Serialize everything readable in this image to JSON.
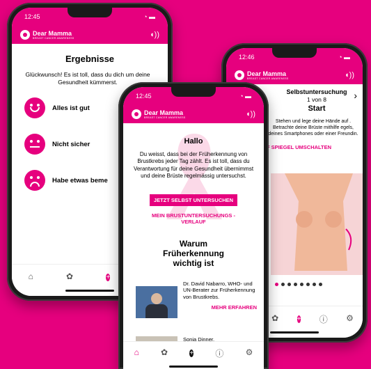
{
  "left": {
    "time": "12:45",
    "brand": "Dear Mamma",
    "brand_tag": "BREAST CANCER AWARENESS",
    "title": "Ergebnisse",
    "intro": "Glückwunsch! Es ist toll, dass du dich um deine Gesundheit kümmerst.",
    "options": [
      {
        "label": "Alles ist gut",
        "mood": "happy"
      },
      {
        "label": "Nicht sicher",
        "mood": "neutral"
      },
      {
        "label": "Habe etwas beme",
        "mood": "sad"
      }
    ]
  },
  "right": {
    "time": "12:46",
    "brand": "Dear Mamma",
    "brand_tag": "BREAST CANCER AWARENESS",
    "heading": "Selbstuntersuchung",
    "step": "1 von 8",
    "subheading": "Start",
    "text": "Stehen und lege deine Hände auf . Betrachte deine Brüste mithilfe egels, deines Smartphones oder einer Freundin.",
    "switch_label": "F SPIEGEL UMSCHALTEN",
    "next_icon": "chevron-right-icon"
  },
  "center": {
    "time": "12:45",
    "brand": "Dear Mamma",
    "brand_tag": "BREAST CANCER AWARENESS",
    "hello": "Hallo",
    "body": "Du weisst, dass bei der Früherkennung von Brustkrebs jeder Tag zählt. Es ist toll, dass du Verantwortung für deine Gesundheit übernimmst und deine Brüste regelmässig untersuchst.",
    "cta_primary": "JETZT SELBST UNTERSUCHEN",
    "cta_secondary": "MEIN BRUSTUNTERSUCHUNGS -VERLAUF",
    "section_title": "Warum Früherkennung wichtig ist",
    "card1_text": "Dr. David Nabarro, WHO- und UN-Berater zur Früherkennung von Brustkrebs.",
    "card1_link": "MEHR ERFAHREN",
    "card2_text": "Sonja Dinner,"
  },
  "colors": {
    "accent": "#e6007e"
  }
}
